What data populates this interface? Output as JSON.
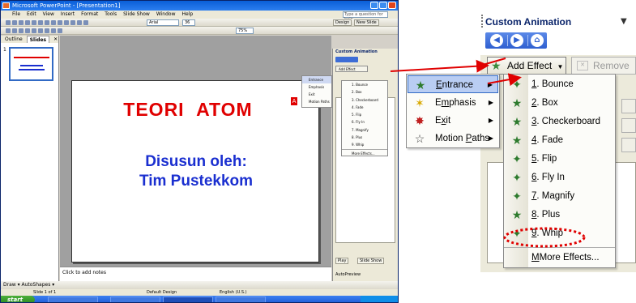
{
  "ppt": {
    "title": "Microsoft PowerPoint - [Presentation1]",
    "menu": [
      "File",
      "Edit",
      "View",
      "Insert",
      "Format",
      "Tools",
      "Slide Show",
      "Window",
      "Help"
    ],
    "help_placeholder": "Type a question for help",
    "font_name": "Arial",
    "font_size": "36",
    "zoom": "75%",
    "design_btn": "Design",
    "new_slide_btn": "New Slide",
    "tabs": [
      "Outline",
      "Slides"
    ],
    "thumb_number": "1",
    "slide": {
      "title": "TEORI ATOM",
      "subtitle_line1": "Disusun oleh:",
      "subtitle_line2": "Tim Pustekkom",
      "marker": "A"
    },
    "notes_placeholder": "Click to add notes",
    "task_pane": {
      "title": "Custom Animation",
      "add_effect": "Add Effect",
      "play": "Play",
      "slide_show": "Slide Show",
      "autopreview": "AutoPreview"
    },
    "mini_categories": [
      "Entrance",
      "Emphasis",
      "Exit",
      "Motion Paths"
    ],
    "mini_effects": [
      "1. Bounce",
      "2. Box",
      "3. Checkerboard",
      "4. Fade",
      "5. Flip",
      "6. Fly In",
      "7. Magnify",
      "8. Plus",
      "9. Whip",
      "More Effects..."
    ],
    "draw_bar": "Draw ▾  AutoShapes ▾",
    "status": {
      "slide": "Slide 1 of 1",
      "design": "Default Design",
      "lang": "English (U.S.)"
    },
    "taskbar": {
      "start": "start",
      "tray_time": ""
    }
  },
  "zoom": {
    "title": "Custom Animation",
    "add_effect": "Add Effect",
    "remove": "Remove",
    "list_snippet_1": "e,",
    "list_snippet_2": "d"
  },
  "categories": [
    {
      "label": "Entrance",
      "mnemonic": "E",
      "rest": "ntrance",
      "icon": "entrance-star-icon"
    },
    {
      "label": "Emphasis",
      "mnemonic": "m",
      "pre": "E",
      "rest": "phasis",
      "icon": "emphasis-star-icon"
    },
    {
      "label": "Exit",
      "mnemonic": "x",
      "pre": "E",
      "rest": "it",
      "icon": "exit-star-icon"
    },
    {
      "label": "Motion Paths",
      "mnemonic": "P",
      "pre": "Motion ",
      "rest": "aths",
      "icon": "motion-star-icon"
    }
  ],
  "effects": [
    {
      "num": "1",
      "name": ". Bounce"
    },
    {
      "num": "2",
      "name": ". Box"
    },
    {
      "num": "3",
      "name": ". Checkerboard"
    },
    {
      "num": "4",
      "name": ". Fade"
    },
    {
      "num": "5",
      "name": ". Flip"
    },
    {
      "num": "6",
      "name": ". Fly In"
    },
    {
      "num": "7",
      "name": ". Magnify"
    },
    {
      "num": "8",
      "name": ". Plus"
    },
    {
      "num": "9",
      "name": ". Whip"
    }
  ],
  "more_effects": "More Effects...",
  "colors": {
    "title_red": "#e00000",
    "subtitle_blue": "#1a2fd0",
    "callout_red": "#e00000",
    "selection": "#b9cdf3"
  }
}
